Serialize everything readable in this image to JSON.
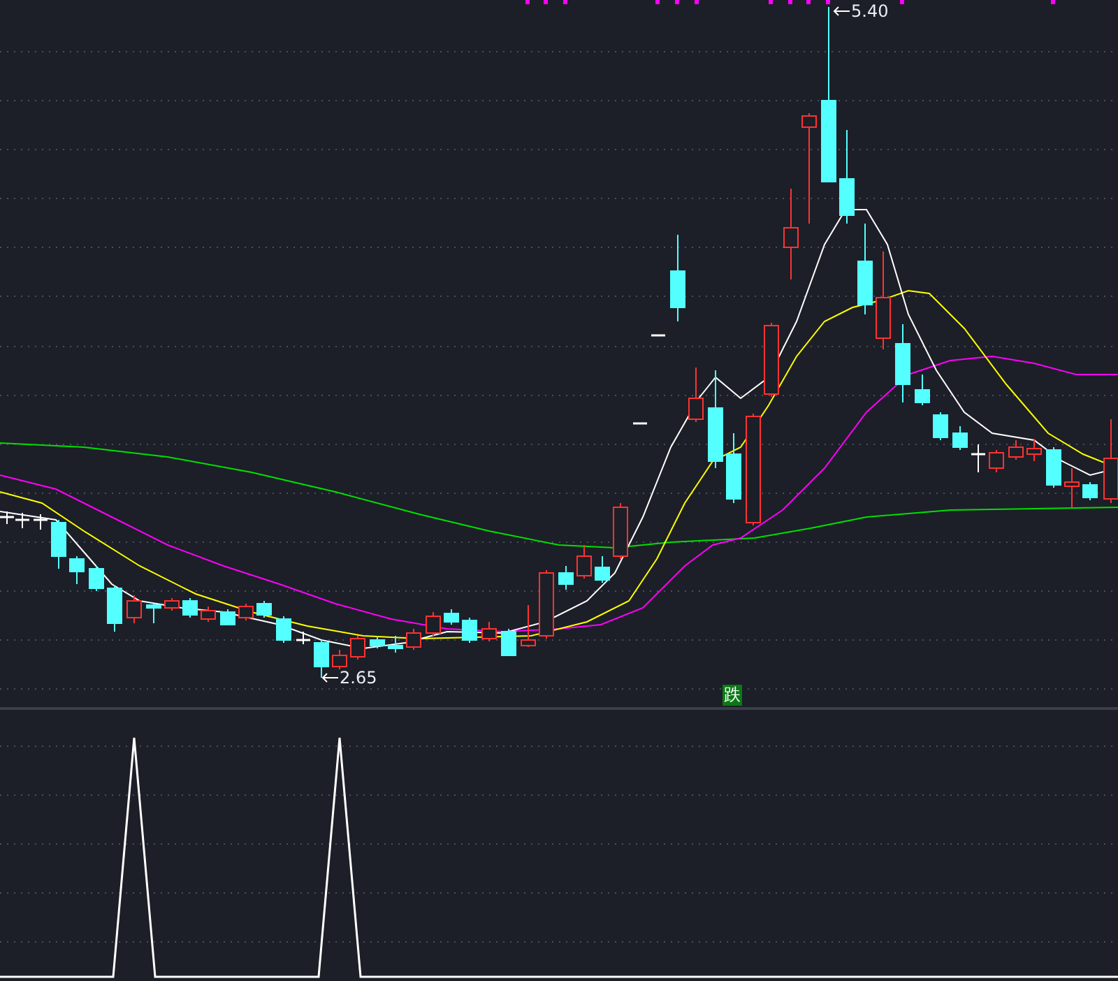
{
  "price_chart": {
    "high_label": "5.40",
    "low_label": "2.65",
    "signal_label": "跌"
  }
}
